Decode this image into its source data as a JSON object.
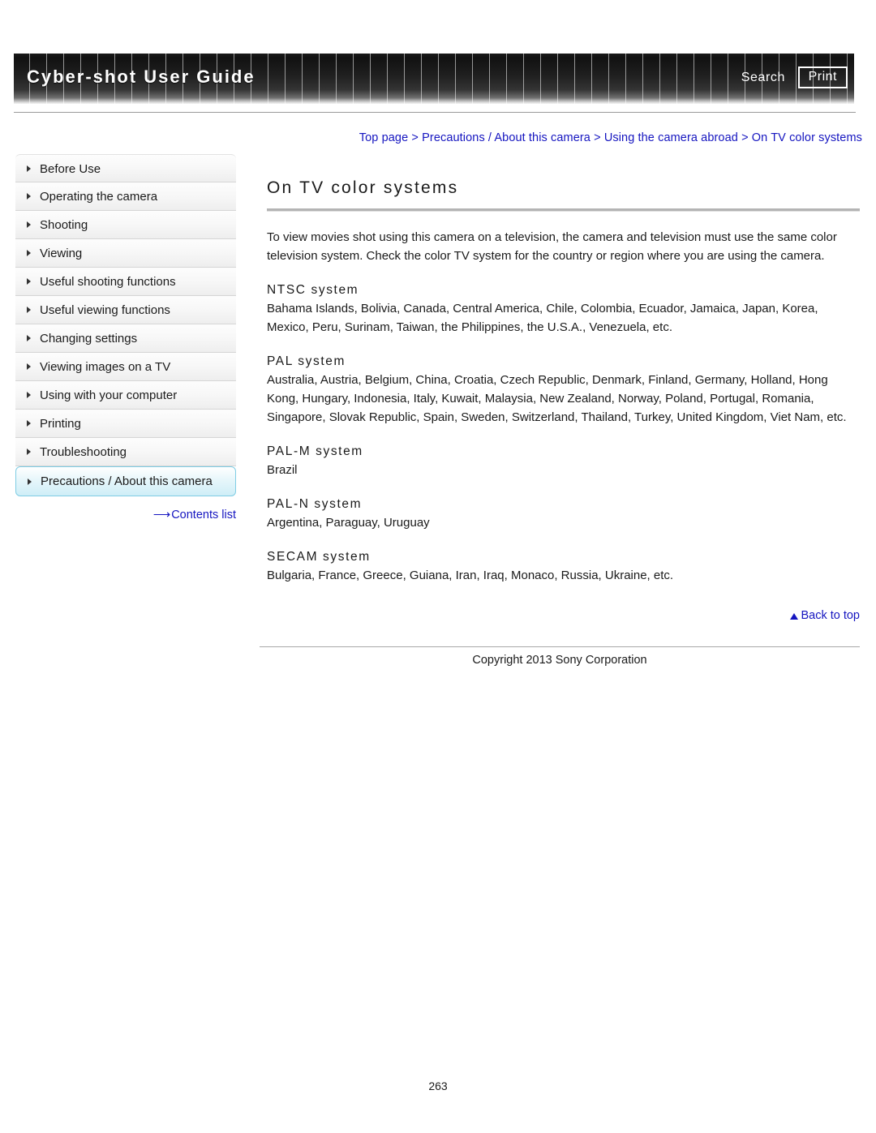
{
  "header": {
    "title": "Cyber-shot User Guide",
    "search_label": "Search",
    "print_label": "Print"
  },
  "breadcrumb": {
    "items": [
      "Top page",
      "Precautions / About this camera",
      "Using the camera abroad",
      "On TV color systems"
    ],
    "separator": ">",
    "full_text": "Top page > Precautions / About this camera > Using the camera abroad > On TV color systems"
  },
  "sidebar": {
    "items": [
      {
        "label": "Before Use",
        "selected": false
      },
      {
        "label": "Operating the camera",
        "selected": false
      },
      {
        "label": "Shooting",
        "selected": false
      },
      {
        "label": "Viewing",
        "selected": false
      },
      {
        "label": "Useful shooting functions",
        "selected": false
      },
      {
        "label": "Useful viewing functions",
        "selected": false
      },
      {
        "label": "Changing settings",
        "selected": false
      },
      {
        "label": "Viewing images on a TV",
        "selected": false
      },
      {
        "label": "Using with your computer",
        "selected": false
      },
      {
        "label": "Printing",
        "selected": false
      },
      {
        "label": "Troubleshooting",
        "selected": false
      },
      {
        "label": "Precautions / About this camera",
        "selected": true
      }
    ],
    "contents_list_label": "Contents list",
    "contents_list_arrow": "⟶"
  },
  "main": {
    "title": "On TV color systems",
    "intro": "To view movies shot using this camera on a television, the camera and television must use the same color television system. Check the color TV system for the country or region where you are using the camera.",
    "sections": [
      {
        "heading": "NTSC system",
        "body": "Bahama Islands, Bolivia, Canada, Central America, Chile, Colombia, Ecuador, Jamaica, Japan, Korea, Mexico, Peru, Surinam, Taiwan, the Philippines, the U.S.A., Venezuela, etc."
      },
      {
        "heading": "PAL system",
        "body": "Australia, Austria, Belgium, China, Croatia, Czech Republic, Denmark, Finland, Germany, Holland, Hong Kong, Hungary, Indonesia, Italy, Kuwait, Malaysia, New Zealand, Norway, Poland, Portugal, Romania, Singapore, Slovak Republic, Spain, Sweden, Switzerland, Thailand, Turkey, United Kingdom, Viet Nam, etc."
      },
      {
        "heading": "PAL-M system",
        "body": "Brazil"
      },
      {
        "heading": "PAL-N system",
        "body": "Argentina, Paraguay, Uruguay"
      },
      {
        "heading": "SECAM system",
        "body": "Bulgaria, France, Greece, Guiana, Iran, Iraq, Monaco, Russia, Ukraine, etc."
      }
    ]
  },
  "footer": {
    "back_to_top_label": "Back to top",
    "copyright": "Copyright 2013 Sony Corporation",
    "page_number": "263"
  },
  "colors": {
    "link_blue": "#1515c0",
    "banner_dark": "#111111",
    "selected_cyan": "#cfeef7",
    "selected_border": "#7fcde4"
  }
}
